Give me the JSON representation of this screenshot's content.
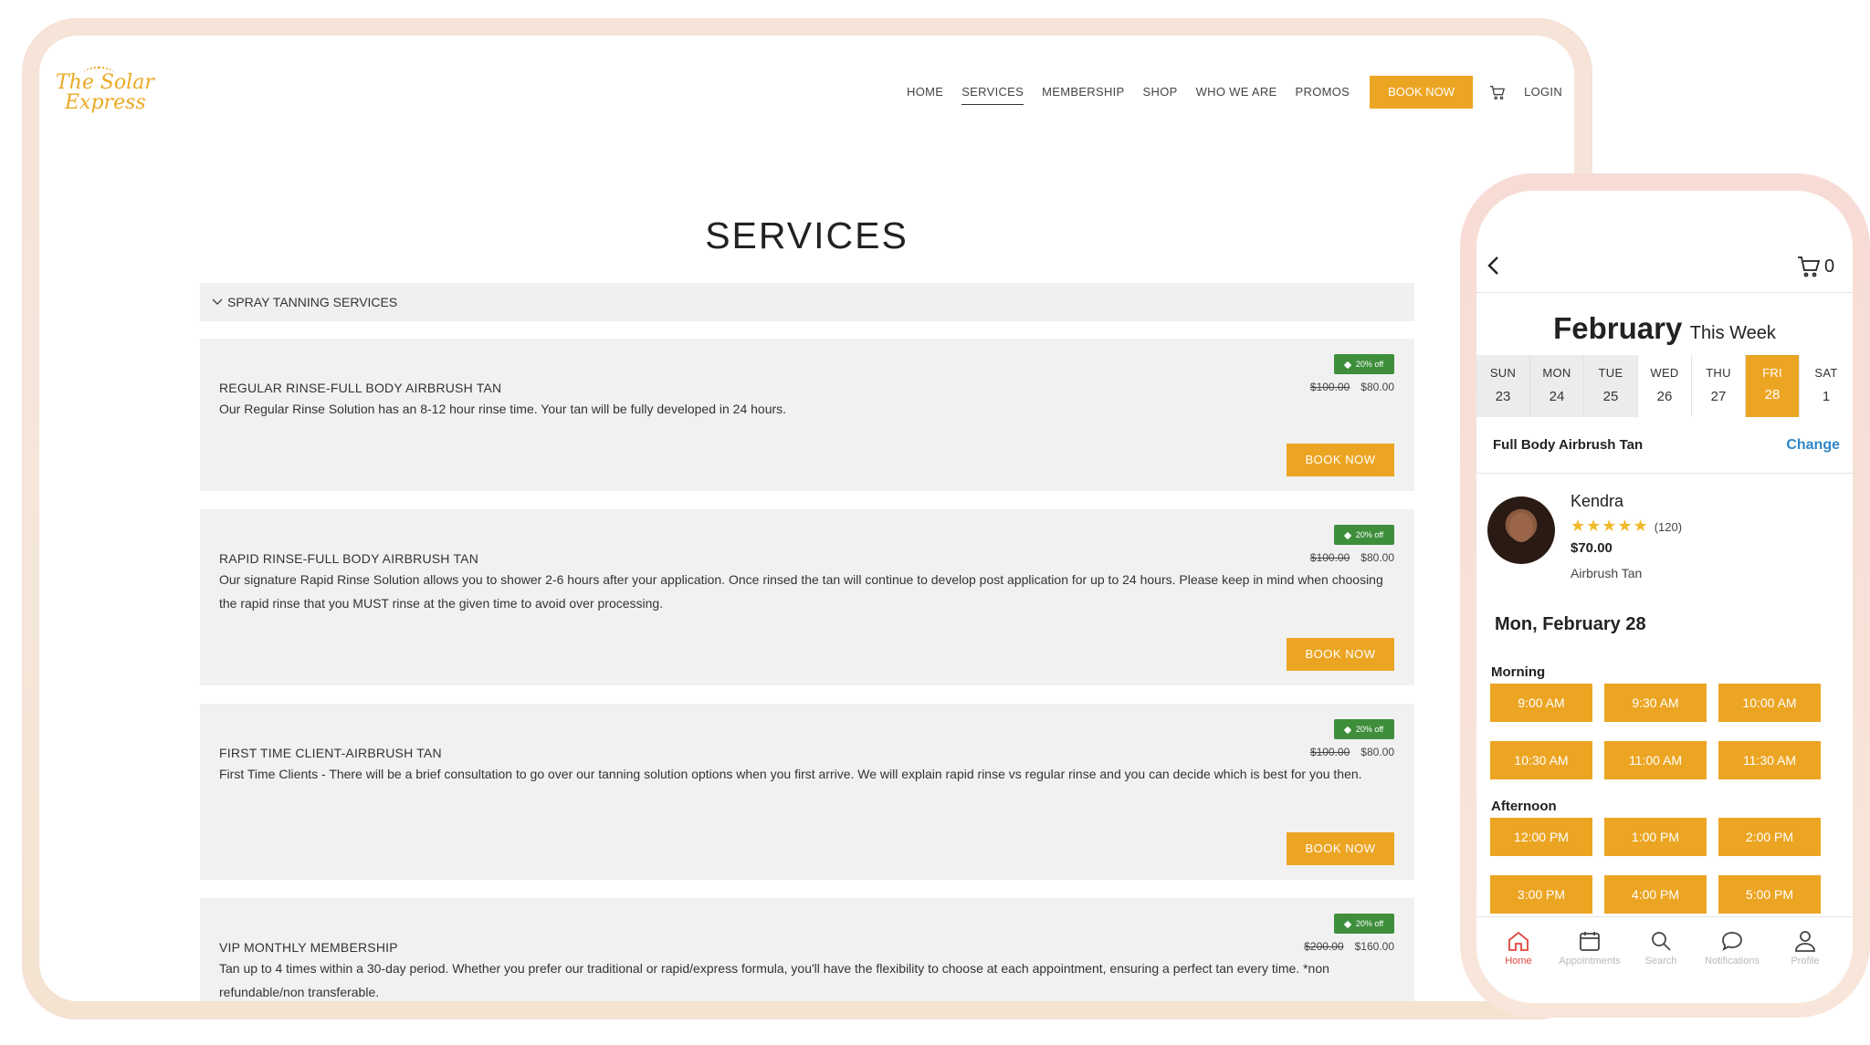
{
  "desktop": {
    "logo": {
      "line1": "The Solar",
      "line2": "Express"
    },
    "nav": {
      "items": [
        "HOME",
        "SERVICES",
        "MEMBERSHIP",
        "SHOP",
        "WHO WE ARE",
        "PROMOS"
      ],
      "book_label": "BOOK NOW",
      "login_label": "LOGIN",
      "active": "SERVICES"
    },
    "page_title": "SERVICES",
    "section_title": "SPRAY TANNING SERVICES",
    "services": [
      {
        "name": "REGULAR RINSE-FULL BODY AIRBRUSH TAN",
        "description": "Our Regular Rinse Solution has an 8-12 hour rinse time. Your tan will be fully developed in 24 hours.",
        "badge": "20% off",
        "old_price": "$100.00",
        "price": "$80.00",
        "book_label": "BOOK NOW"
      },
      {
        "name": "RAPID RINSE-FULL BODY AIRBRUSH TAN",
        "description": "Our signature Rapid Rinse Solution allows you to shower 2-6 hours after your application. Once rinsed the tan will continue to develop post application for up to 24 hours. Please keep in mind when choosing the rapid rinse that you MUST rinse at the given time to avoid over processing.",
        "badge": "20% off",
        "old_price": "$100.00",
        "price": "$80.00",
        "book_label": "BOOK NOW"
      },
      {
        "name": "FIRST TIME CLIENT-AIRBRUSH TAN",
        "description": "First Time Clients - There will be a brief consultation to go over our tanning solution options when you first arrive. We will explain rapid rinse vs regular rinse and you can decide which is best for you then.",
        "badge": "20% off",
        "old_price": "$100.00",
        "price": "$80.00",
        "book_label": "BOOK NOW"
      },
      {
        "name": "VIP MONTHLY MEMBERSHIP",
        "description": "Tan up to 4 times within a 30-day period. Whether you prefer our traditional or rapid/express formula, you'll have the flexibility to choose at each appointment, ensuring a perfect tan every time. *non refundable/non transferable.",
        "badge": "20% off",
        "old_price": "$200.00",
        "price": "$160.00"
      }
    ]
  },
  "mobile": {
    "cart_count": "0",
    "month": "February",
    "week_label": "This Week",
    "days": [
      {
        "name": "SUN",
        "date": "23"
      },
      {
        "name": "MON",
        "date": "24"
      },
      {
        "name": "TUE",
        "date": "25"
      },
      {
        "name": "WED",
        "date": "26"
      },
      {
        "name": "THU",
        "date": "27"
      },
      {
        "name": "FRI",
        "date": "28"
      },
      {
        "name": "SAT",
        "date": "1"
      }
    ],
    "selected_day": "FRI",
    "service_name": "Full Body Airbrush Tan",
    "change_label": "Change",
    "stylist": {
      "name": "Kendra",
      "rating": 5,
      "review_count": "(120)",
      "price": "$70.00",
      "service": "Airbrush Tan"
    },
    "selected_date": "Mon, February 28",
    "morning_label": "Morning",
    "morning_slots": [
      "9:00 AM",
      "9:30 AM",
      "10:00 AM",
      "10:30 AM",
      "11:00 AM",
      "11:30 AM"
    ],
    "afternoon_label": "Afternoon",
    "afternoon_slots": [
      "12:00 PM",
      "1:00 PM",
      "2:00 PM",
      "3:00 PM",
      "4:00 PM",
      "5:00 PM"
    ],
    "tabs": [
      {
        "label": "Home",
        "icon": "home-icon"
      },
      {
        "label": "Appointments",
        "icon": "calendar-icon"
      },
      {
        "label": "Search",
        "icon": "search-icon"
      },
      {
        "label": "Notifications",
        "icon": "chat-bubble-icon"
      },
      {
        "label": "Profile",
        "icon": "user-icon"
      }
    ],
    "active_tab": "Home"
  },
  "colors": {
    "accent": "#eca523",
    "badge_green": "#3e8e3b",
    "link_blue": "#2f86c7",
    "active_tab_red": "#e0453b"
  }
}
